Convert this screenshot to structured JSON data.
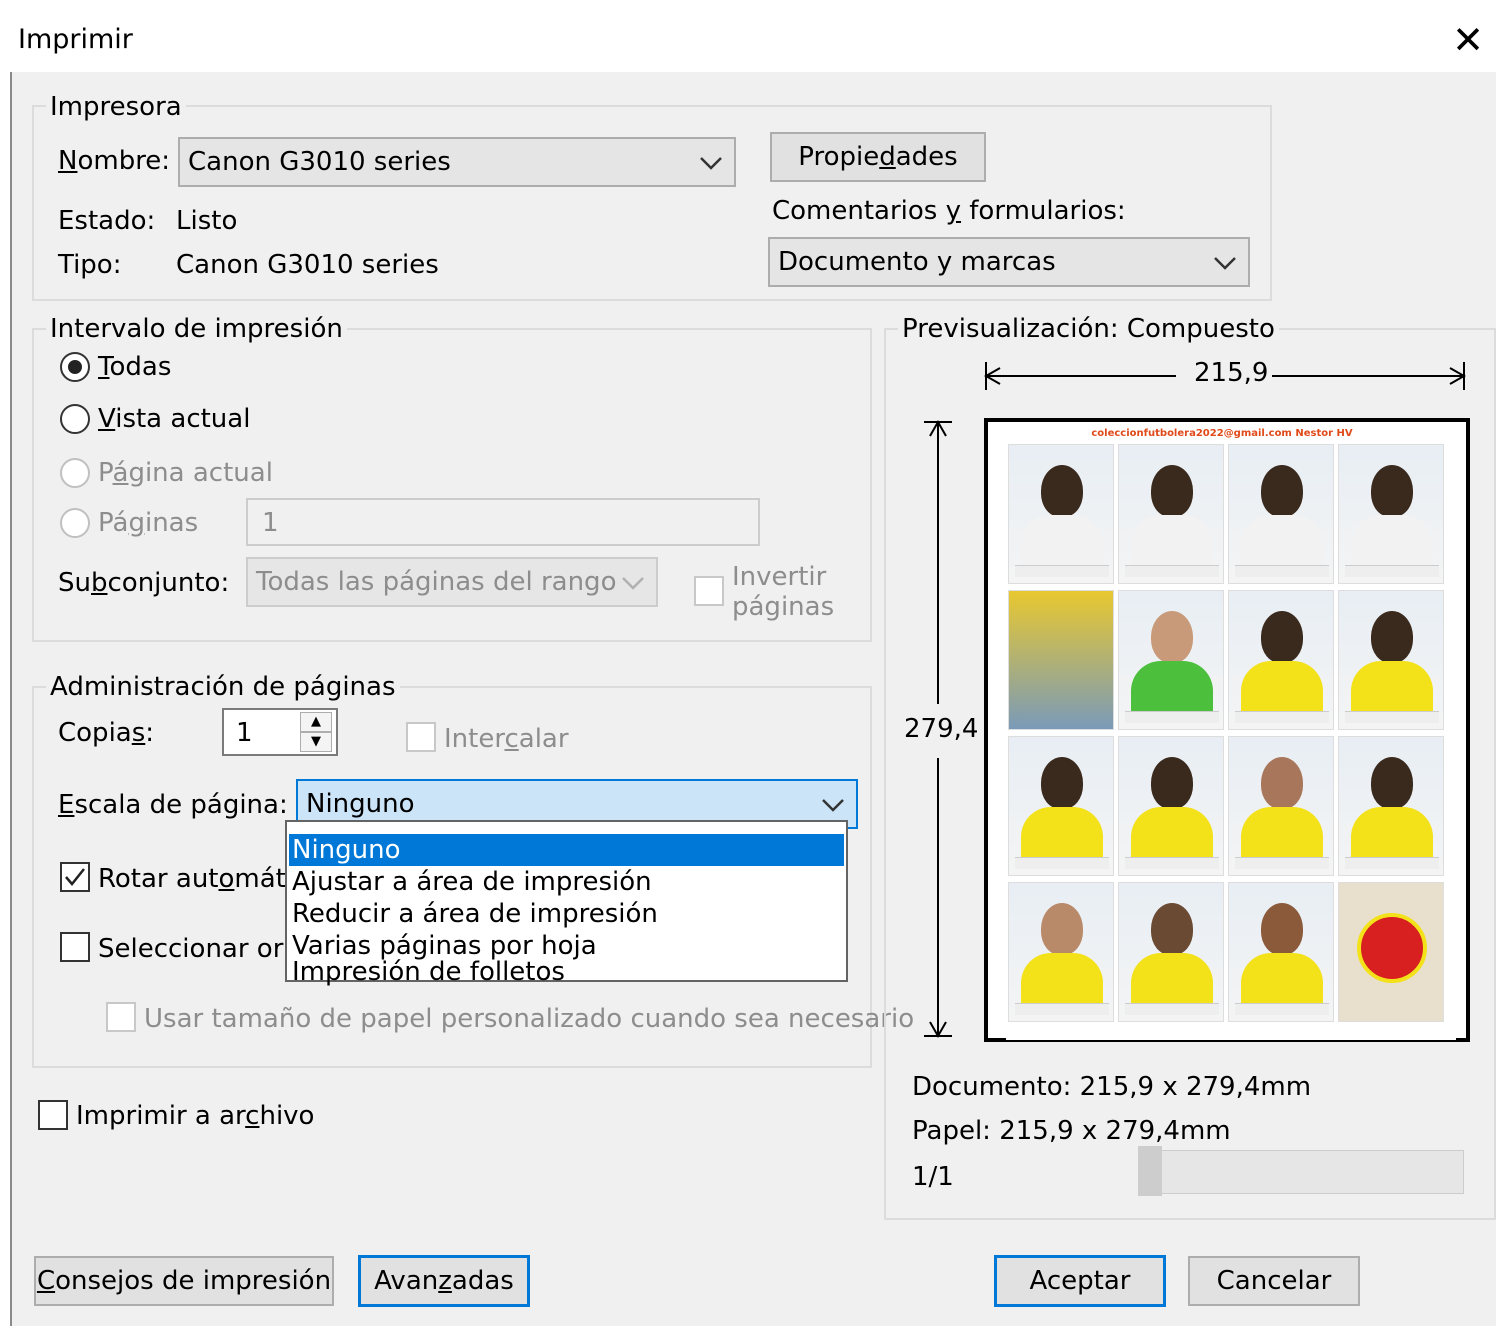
{
  "window": {
    "title": "Imprimir"
  },
  "printer": {
    "group_label": "Impresora",
    "name_label": "Nombre:",
    "name_value": "Canon G3010 series",
    "properties_button": "Propiedades",
    "status_label": "Estado:",
    "status_value": "Listo",
    "type_label": "Tipo:",
    "type_value": "Canon G3010 series",
    "comments_label": "Comentarios y formularios:",
    "comments_value": "Documento y marcas"
  },
  "range": {
    "group_label": "Intervalo de impresión",
    "all": "Todas",
    "current_view": "Vista actual",
    "current_page": "Página actual",
    "pages": "Páginas",
    "pages_value": "1",
    "subset_label": "Subconjunto:",
    "subset_value": "Todas las páginas del rango",
    "reverse_line1": "Invertir",
    "reverse_line2": "páginas"
  },
  "page_handling": {
    "group_label": "Administración de páginas",
    "copies_label": "Copias:",
    "copies_value": "1",
    "collate_label": "Intercalar",
    "scale_label": "Escala de página:",
    "scale_value": "Ninguno",
    "scale_options": [
      "Ninguno",
      "Ajustar a área de impresión",
      "Reducir a área de impresión",
      "Varias páginas por hoja",
      "Impresión de folletos"
    ],
    "auto_rotate_label": "Rotar automática",
    "choose_source_label": "Seleccionar orige",
    "custom_paper_label": "Usar tamaño de papel personalizado cuando sea necesario"
  },
  "print_to_file": "Imprimir a archivo",
  "preview": {
    "group_label": "Previsualización: Compuesto",
    "width_value": "215,9",
    "height_value": "279,4",
    "document_size": "Documento: 215,9 x 279,4mm",
    "paper_size": "Papel: 215,9 x 279,4mm",
    "page_counter": "1/1",
    "sheet_header": "coleccionfutbolera2022@gmail.com   Nestor HV"
  },
  "buttons": {
    "tips": "Consejos de impresión",
    "advanced": "Avanzadas",
    "ok": "Aceptar",
    "cancel": "Cancelar"
  },
  "colors": {
    "accent": "#0078d7",
    "dialog_bg": "#f0f0f0",
    "disabled_text": "#8d8d8d"
  }
}
